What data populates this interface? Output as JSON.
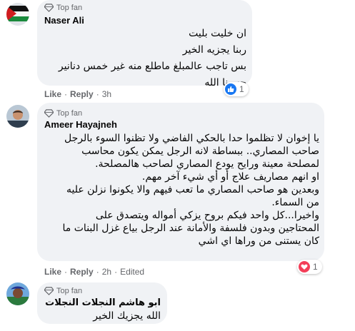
{
  "comments": [
    {
      "badge": "Top fan",
      "name": "Naser Ali",
      "lines": [
        "ان خليت بليت",
        "ربنا يجزيه الخير",
        "بس تاجب عالمبلغ ماطلع منه غير خمس دنانير",
        "حسبنا الله"
      ],
      "actions": {
        "like": "Like",
        "reply": "Reply",
        "time": "3h"
      },
      "reaction": {
        "icon": "thumbs-up-icon",
        "count": "1"
      }
    },
    {
      "badge": "Top fan",
      "name": "Ameer Hayajneh",
      "lines": [
        "يا إخوان لا تظلموا حدا بالحكي الفاضي ولا تظنوا السوء بالرجل",
        "صاحب المصاري.. ببساطة لانه الرجل يمكن يكون محاسب",
        "لمصلحة معينة ورايح يودع المصاري لصاحب هالمصلحة.",
        "او انهم مصاريف علاج أو أي شيء آخر مهم.",
        "وبعدين هو صاحب المصاري ما تعب فيهم والا يكونوا نزلن عليه",
        "من السماء.",
        "واخيرا...كل واحد فيكم بروح يزكي أمواله ويتصدق على",
        "المحتاجين وبدون فلسفة والأمانة عند الرجل بياع غزل البنات ما",
        "كان يستنى من وراها اي اشي"
      ],
      "actions": {
        "like": "Like",
        "reply": "Reply",
        "time": "2h",
        "edited": "Edited"
      },
      "reaction": {
        "icon": "heart-icon",
        "count": "1"
      }
    },
    {
      "badge": "Top fan",
      "name": "ابو هاشم النجلات النجلات",
      "lines": [
        "الله يجزيك الخير"
      ]
    }
  ],
  "colors": {
    "like_blue": "#1877f2",
    "love_red": "#f33e58",
    "bubble": "#f0f2f5",
    "meta": "#65676b"
  }
}
